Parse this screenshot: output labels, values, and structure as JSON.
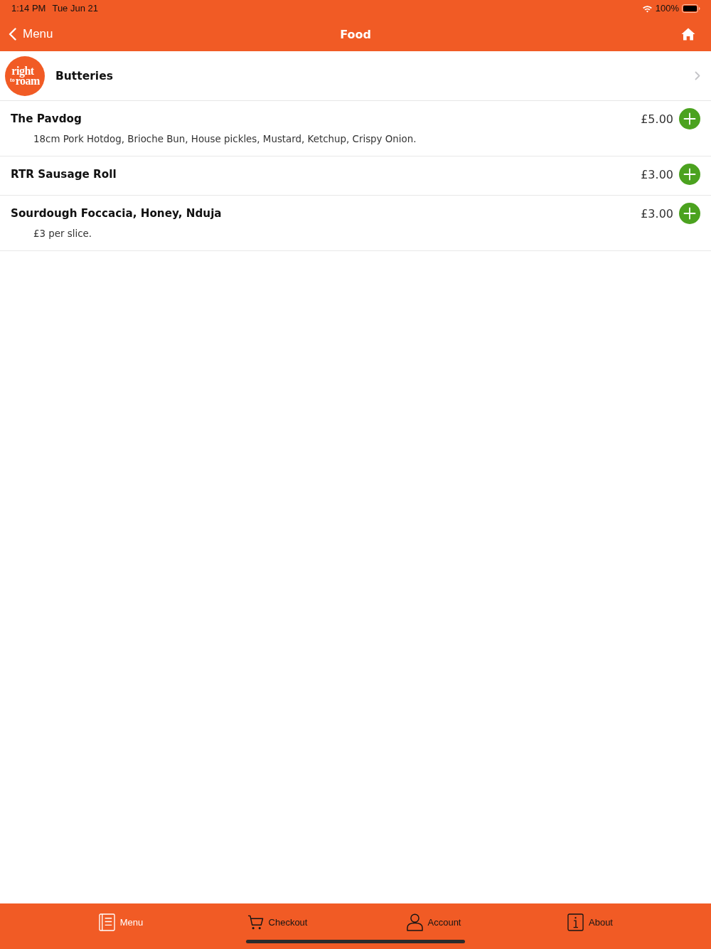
{
  "status_bar": {
    "time": "1:14 PM",
    "date": "Tue Jun 21",
    "battery": "100%"
  },
  "nav_bar": {
    "back_label": "Menu",
    "title": "Food"
  },
  "category": {
    "logo": {
      "word_1": "right",
      "word_2": "to",
      "word_3": "roam"
    },
    "name": "Butteries"
  },
  "items": [
    {
      "name": "The Pavdog",
      "price": "£5.00",
      "description": "18cm Pork Hotdog, Brioche Bun, House pickles, Mustard, Ketchup, Crispy Onion."
    },
    {
      "name": "RTR Sausage Roll",
      "price": "£3.00"
    },
    {
      "name": "Sourdough Foccacia, Honey, Nduja",
      "price": "£3.00",
      "description": "£3 per slice."
    }
  ],
  "tab_bar": [
    {
      "kind": "book",
      "label": "Menu",
      "selected": true
    },
    {
      "kind": "cart",
      "label": "Checkout",
      "selected": false
    },
    {
      "kind": "person",
      "label": "Account",
      "selected": false
    },
    {
      "kind": "info",
      "label": "About",
      "selected": false
    }
  ]
}
